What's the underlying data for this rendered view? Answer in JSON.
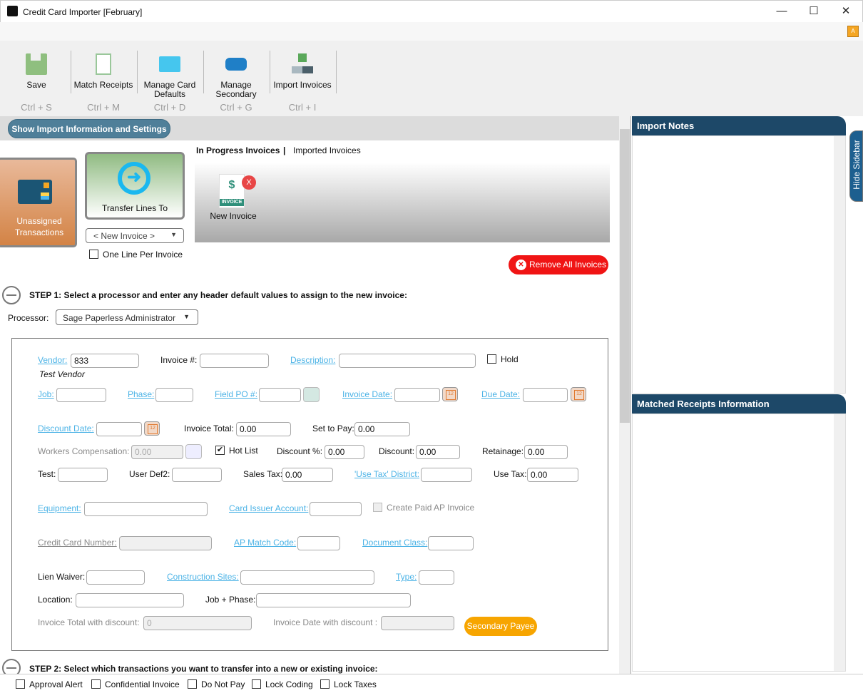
{
  "window": {
    "title": "Credit Card Importer [February]",
    "minimize": "—",
    "maximize": "☐",
    "close": "✕"
  },
  "toolbar": [
    {
      "label": "Save",
      "shortcut": "Ctrl + S",
      "icon": "save-icon"
    },
    {
      "label": "Match Receipts",
      "shortcut": "Ctrl + M",
      "icon": "match-receipts-icon"
    },
    {
      "label": "Manage Card Defaults",
      "shortcut": "Ctrl + D",
      "icon": "card-defaults-icon"
    },
    {
      "label": "Manage Secondary",
      "shortcut": "Ctrl + G",
      "icon": "secondary-icon"
    },
    {
      "label": "Import Invoices",
      "shortcut": "Ctrl + I",
      "icon": "import-icon"
    }
  ],
  "show_import_button": "Show Import Information and Settings",
  "unassigned": "Unassigned Transactions",
  "transfer": {
    "label": "Transfer Lines To",
    "target": "< New Invoice >",
    "one_line_label": "One Line Per Invoice",
    "one_line_checked": false
  },
  "invoice_tabs": {
    "active": "In Progress Invoices",
    "sep": "|",
    "other": "Imported Invoices"
  },
  "invoices": [
    {
      "label": "New Invoice",
      "badge": "X",
      "doc_text": "INVOICE",
      "symbol": "$"
    }
  ],
  "remove_all": "Remove All Invoices",
  "step1": "STEP 1: Select a processor and enter any header default values to assign to the new invoice:",
  "step2": "STEP 2: Select which transactions you want to transfer into a new or existing invoice:",
  "processor": {
    "label": "Processor:",
    "value": "Sage Paperless Administrator"
  },
  "form": {
    "vendor": {
      "label": "Vendor:",
      "value": "833",
      "name": "Test Vendor"
    },
    "invoice_no": "Invoice #:",
    "description": "Description:",
    "hold": "Hold",
    "job": "Job:",
    "phase": "Phase:",
    "field_po": "Field PO #:",
    "invoice_date": "Invoice Date:",
    "due_date": "Due Date:",
    "discount_date": "Discount Date:",
    "invoice_total": {
      "label": "Invoice Total:",
      "value": "0.00"
    },
    "set_to_pay": {
      "label": "Set to Pay:",
      "value": "0.00"
    },
    "workers_comp": {
      "label": "Workers Compensation:",
      "value": "0.00"
    },
    "hot_list": "Hot List",
    "hot_list_checked": true,
    "discount_pct": {
      "label": "Discount %:",
      "value": "0.00"
    },
    "discount": {
      "label": "Discount:",
      "value": "0.00"
    },
    "retainage": {
      "label": "Retainage:",
      "value": "0.00"
    },
    "test": "Test:",
    "user_def2": "User Def2:",
    "sales_tax": {
      "label": "Sales Tax:",
      "value": "0.00"
    },
    "use_tax_district": "'Use Tax' District:",
    "use_tax": {
      "label": "Use Tax:",
      "value": "0.00"
    },
    "equipment": "Equipment:",
    "card_issuer": "Card Issuer Account:",
    "create_paid": "Create Paid AP Invoice",
    "cc_number": "Credit Card Number:",
    "ap_match": "AP Match Code:",
    "doc_class": "Document Class:",
    "lien_waiver": "Lien Waiver:",
    "construction_sites": "Construction Sites:",
    "type": "Type:",
    "location": "Location:",
    "job_phase": "Job + Phase:",
    "total_with_discount": {
      "label": "Invoice Total with discount:",
      "value": "0"
    },
    "date_with_discount": "Invoice Date with discount :",
    "secondary_payee": "Secondary Payee"
  },
  "sidebar": {
    "import_notes": "Import Notes",
    "matched": "Matched Receipts Information",
    "hide": "Hide Sidebar"
  },
  "footer": [
    "Approval Alert",
    "Confidential Invoice",
    "Do Not Pay",
    "Lock Coding",
    "Lock Taxes"
  ],
  "colors": {
    "link": "#4cb3e6",
    "header": "#1d4868",
    "remove": "#ee1111",
    "secondary": "#f7a500"
  }
}
